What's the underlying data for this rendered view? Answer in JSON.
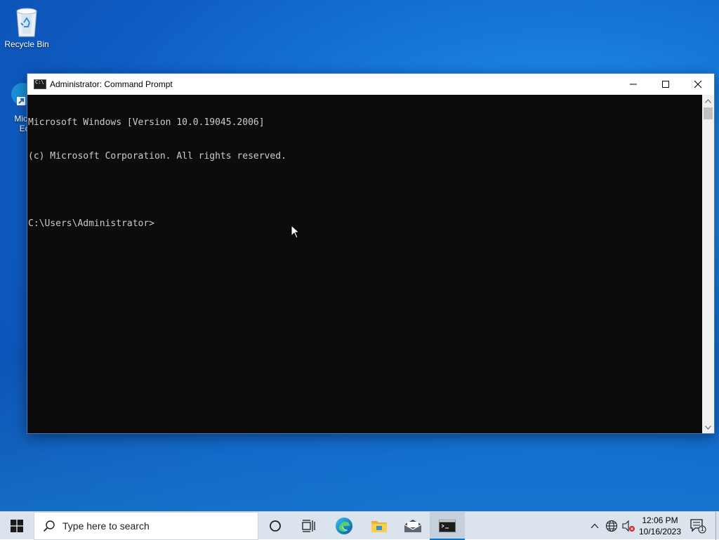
{
  "desktop": {
    "icons": [
      {
        "label": "Recycle Bin"
      },
      {
        "label_line1": "Micro",
        "label_line2": "Ed"
      }
    ]
  },
  "window": {
    "title": "Administrator: Command Prompt",
    "console_lines": [
      "Microsoft Windows [Version 10.0.19045.2006]",
      "(c) Microsoft Corporation. All rights reserved.",
      "",
      "C:\\Users\\Administrator>"
    ]
  },
  "taskbar": {
    "search_placeholder": "Type here to search",
    "clock_time": "12:06 PM",
    "clock_date": "10/16/2023",
    "notification_count": "1",
    "pinned": [
      "task-view",
      "edge",
      "file-explorer",
      "mail",
      "command-prompt"
    ]
  },
  "colors": {
    "console_bg": "#0c0c0c",
    "console_fg": "#cccccc",
    "taskbar_bg": "#dbe3ec",
    "accent": "#0078d4"
  }
}
